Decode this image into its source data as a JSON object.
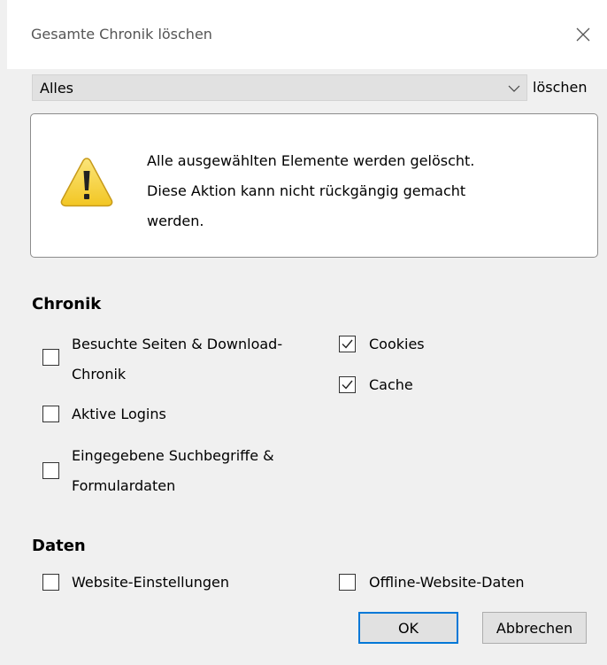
{
  "window": {
    "title": "Gesamte Chronik löschen"
  },
  "range": {
    "selected": "Alles",
    "suffix_label": "löschen"
  },
  "warning": {
    "line1": "Alle ausgewählten Elemente werden gelöscht.",
    "line2": "Diese Aktion kann nicht rückgängig gemacht",
    "line3": "werden."
  },
  "history": {
    "title": "Chronik",
    "items": [
      {
        "line1": "Besuchte Seiten & Download-",
        "line2": "Chronik",
        "checked": false
      },
      {
        "line1": "Aktive Logins",
        "checked": false
      },
      {
        "line1": "Eingegebene Suchbegriffe &",
        "line2": "Formulardaten",
        "checked": false
      },
      {
        "line1": "Cookies",
        "checked": true
      },
      {
        "line1": "Cache",
        "checked": true
      }
    ]
  },
  "data": {
    "title": "Daten",
    "items": [
      {
        "label": "Website-Einstellungen",
        "checked": false
      },
      {
        "label": "Offline-Website-Daten",
        "checked": false
      }
    ]
  },
  "buttons": {
    "ok_label": "OK",
    "cancel_label": "Abbrechen"
  },
  "colors": {
    "accent": "#0078d7",
    "warning_yellow": "#f6d03b"
  },
  "icons": {
    "close": "close-icon",
    "dropdown": "chevron-down-icon",
    "warning": "warning-icon",
    "check": "checkmark-icon"
  }
}
